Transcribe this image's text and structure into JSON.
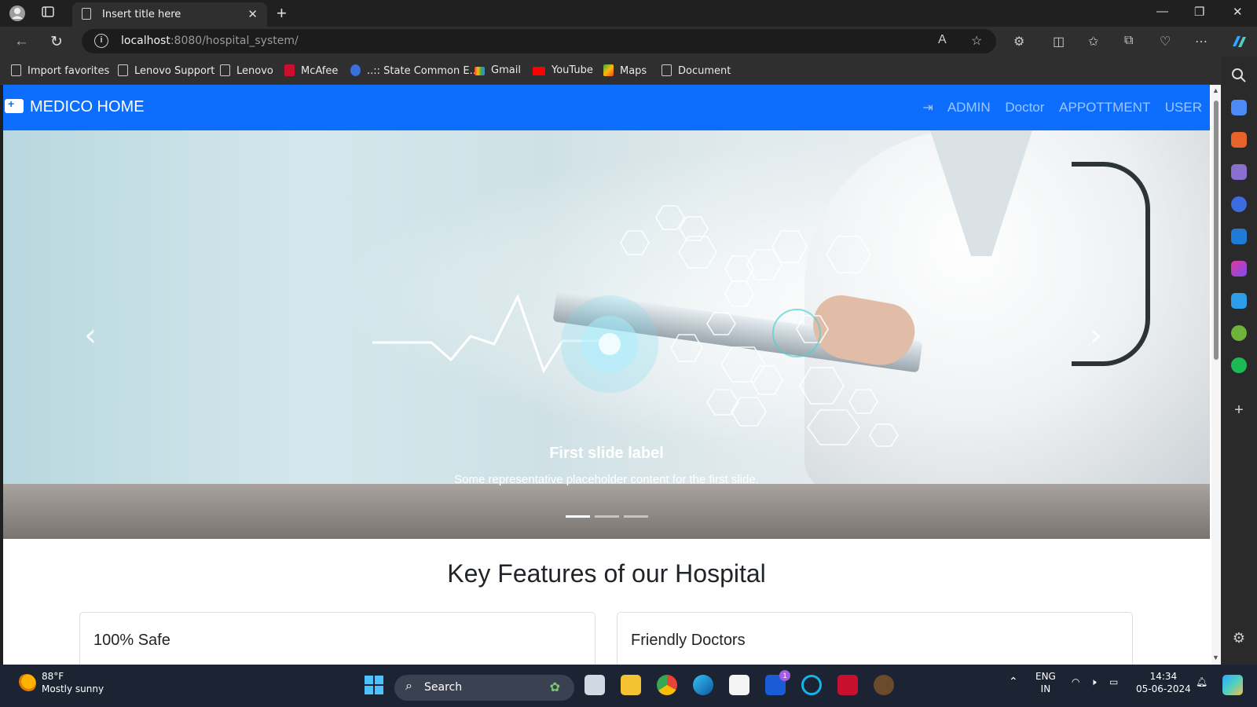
{
  "browser": {
    "tab_title": "Insert title here",
    "url_host": "localhost",
    "url_rest": ":8080/hospital_system/",
    "bookmarks": [
      "Import favorites",
      "Lenovo Support",
      "Lenovo",
      "McAfee",
      "..:: State Common E...",
      "Gmail",
      "YouTube",
      "Maps",
      "Document"
    ]
  },
  "site": {
    "brand": "MEDICO HOME",
    "nav": [
      "ADMIN",
      "Doctor",
      "APPOTTMENT",
      "USER"
    ],
    "carousel": {
      "caption_title": "First slide label",
      "caption_text": "Some representative placeholder content for the first slide.",
      "slide_count": 3,
      "active_slide": 1
    },
    "features_heading": "Key Features of our Hospital",
    "cards": [
      "100% Safe",
      "Friendly Doctors"
    ]
  },
  "taskbar": {
    "weather_temp": "88°F",
    "weather_desc": "Mostly sunny",
    "search_label": "Search",
    "lang_1": "ENG",
    "lang_2": "IN",
    "time": "14:34",
    "date": "05-06-2024",
    "notification_count": "1"
  },
  "colors": {
    "brand": "#0d6efd",
    "taskbar": "#1c2433",
    "chrome": "#2f2f2f"
  }
}
